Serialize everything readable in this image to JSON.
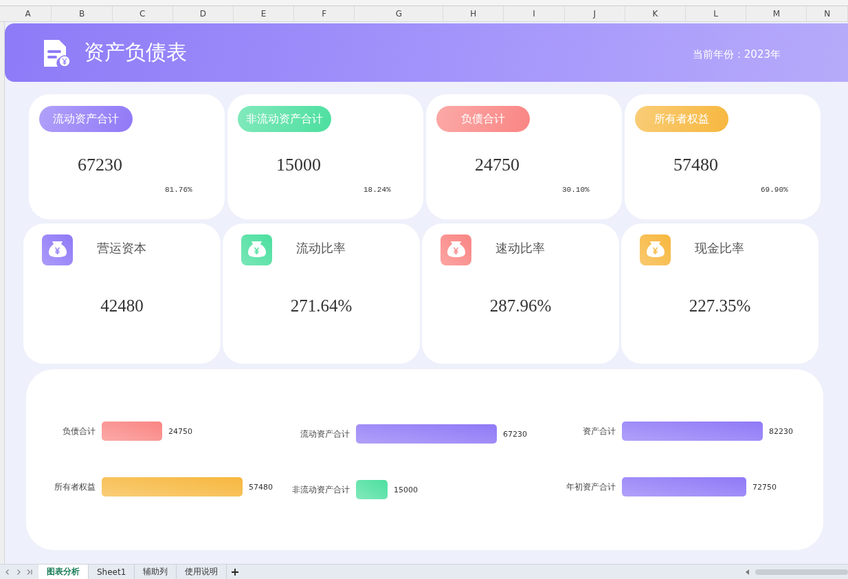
{
  "column_headers": [
    "A",
    "B",
    "C",
    "D",
    "E",
    "F",
    "G",
    "H",
    "I",
    "J",
    "K",
    "L",
    "M",
    "N"
  ],
  "banner": {
    "title": "资产负债表",
    "year_label": "当前年份：2023年"
  },
  "summary_cards": [
    {
      "label": "流动资产合计",
      "value": "67230",
      "share": "81.76%",
      "color": "#9079f7"
    },
    {
      "label": "非流动资产合计",
      "value": "15000",
      "share": "18.24%",
      "color": "#4cdf9f"
    },
    {
      "label": "负债合计",
      "value": "24750",
      "share": "30.10%",
      "color": "#f98583"
    },
    {
      "label": "所有者权益",
      "value": "57480",
      "share": "69.90%",
      "color": "#f7b73e"
    }
  ],
  "ratio_cards": [
    {
      "label": "营运资本",
      "value": "42480",
      "color": "#9079f7"
    },
    {
      "label": "流动比率",
      "value": "271.64%",
      "color": "#4cdf9f"
    },
    {
      "label": "速动比率",
      "value": "287.96%",
      "color": "#f98583"
    },
    {
      "label": "现金比率",
      "value": "227.35%",
      "color": "#f7b73e"
    }
  ],
  "charts": [
    {
      "chart_data": {
        "type": "bar",
        "orientation": "horizontal",
        "categories": [
          "负债合计",
          "所有者权益"
        ],
        "values": [
          24750,
          57480
        ],
        "colors": [
          "#f98583",
          "#f7b73e"
        ],
        "data_labels": true
      }
    },
    {
      "chart_data": {
        "type": "bar",
        "orientation": "horizontal",
        "categories": [
          "流动资产合计",
          "非流动资产合计"
        ],
        "values": [
          67230,
          15000
        ],
        "colors": [
          "#9079f7",
          "#4cdf9f"
        ],
        "data_labels": true
      }
    },
    {
      "chart_data": {
        "type": "bar",
        "orientation": "horizontal",
        "categories": [
          "资产合计",
          "年初资产合计"
        ],
        "values": [
          82230,
          72750
        ],
        "colors": [
          "#9079f7",
          "#9079f7"
        ],
        "data_labels": true
      }
    }
  ],
  "sheet_tabs": [
    {
      "label": "图表分析",
      "selected": true
    },
    {
      "label": "Sheet1",
      "selected": false
    },
    {
      "label": "辅助列",
      "selected": false
    },
    {
      "label": "使用说明",
      "selected": false
    }
  ]
}
